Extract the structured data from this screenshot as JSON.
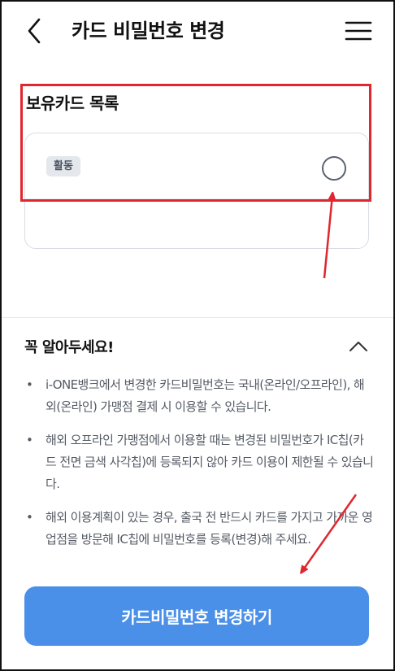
{
  "header": {
    "title": "카드 비밀번호 변경",
    "back_icon": "chevron-left-icon",
    "menu_icon": "hamburger-menu-icon"
  },
  "cards": {
    "section_title": "보유카드 목록",
    "items": [
      {
        "status_badge": "활동",
        "selected": false
      }
    ]
  },
  "notice": {
    "title": "꼭 알아두세요!",
    "toggle_icon": "chevron-up-icon",
    "bullet": "•",
    "items": [
      "i-ONE뱅크에서 변경한 카드비밀번호는 국내(온라인/오프라인), 해외(온라인) 가맹점 결제 시 이용할 수 있습니다.",
      "해외 오프라인 가맹점에서 이용할 때는 변경된 비밀번호가 IC칩(카드 전면 금색 사각칩)에 등록되지 않아 카드 이용이 제한될 수 있습니다.",
      "해외 이용계획이 있는 경우, 출국 전 반드시 카드를 가지고 가까운 영업점을 방문해 IC칩에 비밀번호를 등록(변경)해 주세요."
    ]
  },
  "cta": {
    "label": "카드비밀번호 변경하기"
  },
  "colors": {
    "primary": "#4a90e8",
    "annotation": "#e0262e",
    "badge_bg": "#e4e7ec",
    "text_secondary": "#555b64"
  }
}
